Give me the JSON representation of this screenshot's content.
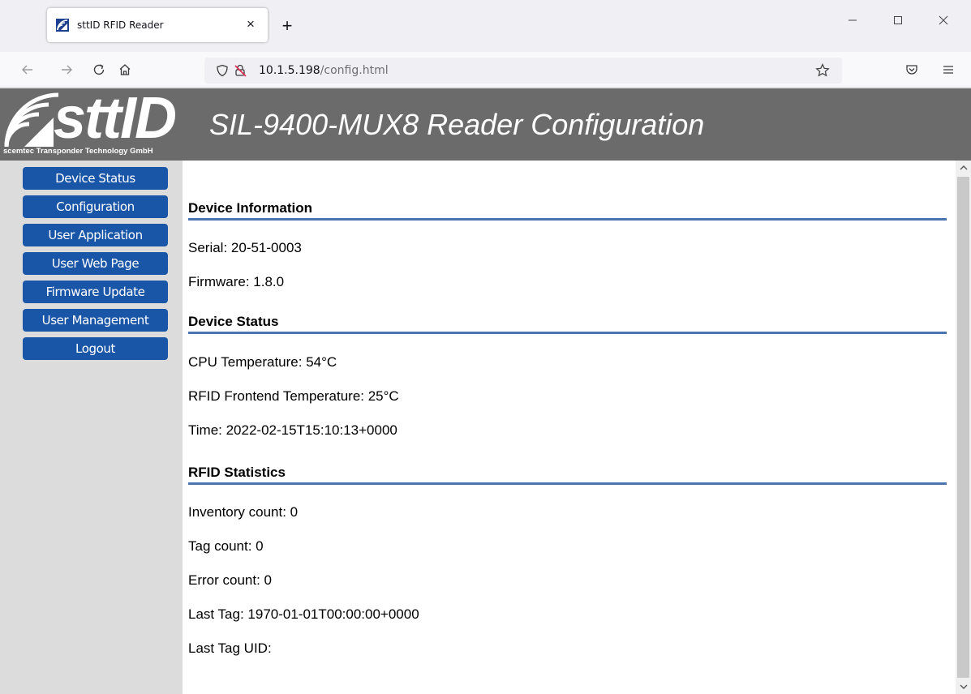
{
  "browser": {
    "tab_title": "sttID RFID Reader",
    "tab_close": "×",
    "new_tab": "+",
    "url_host": "10.1.5.198",
    "url_path": "/config.html"
  },
  "header": {
    "logo_word": "sttID",
    "logo_subtitle": "scemtec Transponder Technology GmbH",
    "title": "SIL-9400-MUX8 Reader Configuration"
  },
  "sidebar": {
    "items": [
      {
        "label": "Device Status"
      },
      {
        "label": "Configuration"
      },
      {
        "label": "User Application"
      },
      {
        "label": "User Web Page"
      },
      {
        "label": "Firmware Update"
      },
      {
        "label": "User Management"
      },
      {
        "label": "Logout"
      }
    ]
  },
  "content": {
    "device_information": {
      "title": "Device Information",
      "serial": "Serial: 20-51-0003",
      "firmware": "Firmware: 1.8.0"
    },
    "device_status": {
      "title": "Device Status",
      "cpu_temp": "CPU Temperature: 54°C",
      "rfid_temp": "RFID Frontend Temperature: 25°C",
      "time": "Time: 2022-02-15T15:10:13+0000"
    },
    "rfid_statistics": {
      "title": "RFID Statistics",
      "inventory_count": "Inventory count: 0",
      "tag_count": "Tag count: 0",
      "error_count": "Error count: 0",
      "last_tag": "Last Tag: 1970-01-01T00:00:00+0000",
      "last_tag_uid": "Last Tag UID:"
    }
  },
  "colors": {
    "header_bg": "#6b6b6b",
    "sidebar_bg": "#dcdcdc",
    "nav_button": "#1a56a8",
    "section_rule": "#4a73b0"
  },
  "icons": {
    "favicon": "sttid-waves-icon",
    "back": "arrow-left-icon",
    "forward": "arrow-right-icon",
    "reload": "reload-icon",
    "home": "home-icon",
    "shield": "shield-icon",
    "lock": "insecure-lock-icon",
    "bookmark": "star-icon",
    "pocket": "pocket-icon",
    "menu": "hamburger-icon"
  }
}
